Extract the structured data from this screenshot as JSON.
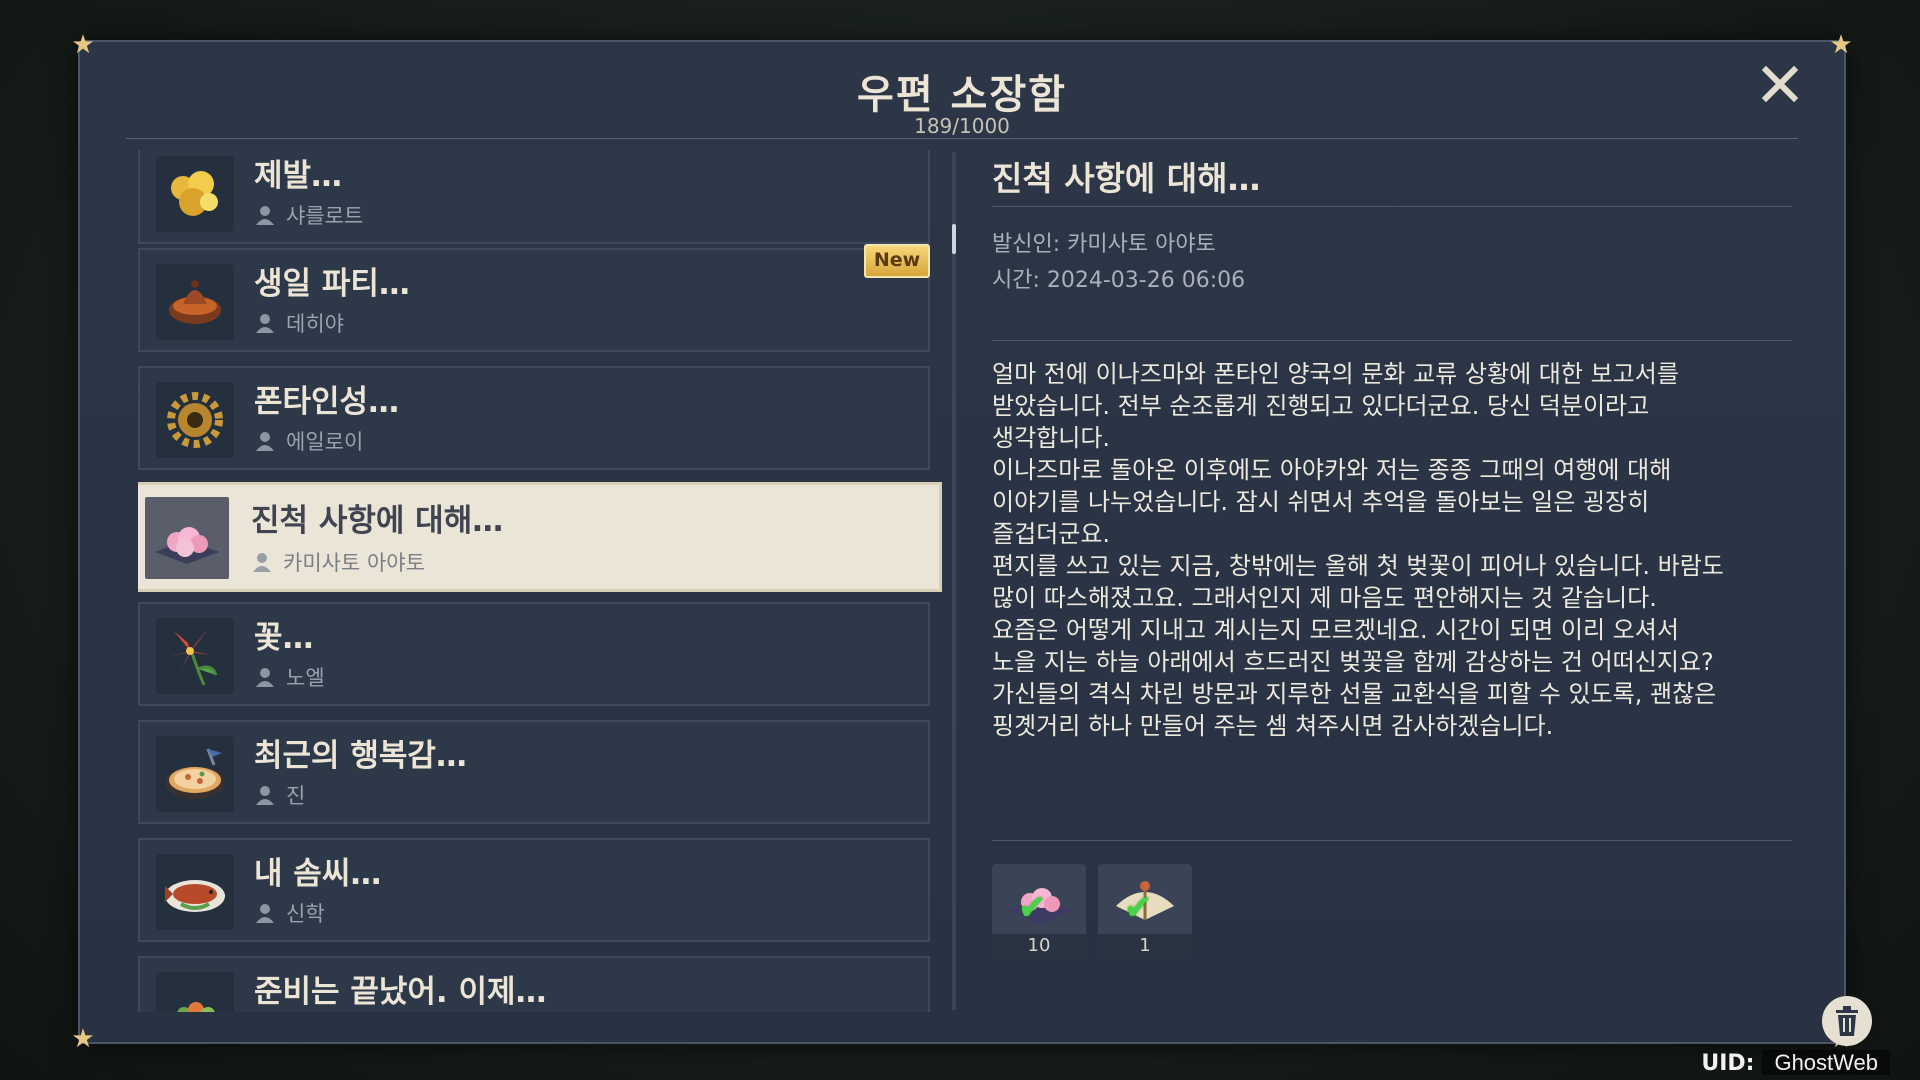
{
  "window": {
    "title": "우편 소장함",
    "count": "189/1000"
  },
  "mail_list": [
    {
      "subject": "제발…",
      "sender": "샤를로트",
      "new": true,
      "icon": "gold-nugget-icon"
    },
    {
      "subject": "생일 파티…",
      "sender": "데히야",
      "new": true,
      "icon": "stew-pot-icon"
    },
    {
      "subject": "폰타인성…",
      "sender": "에일로이",
      "new": false,
      "icon": "gear-icon"
    },
    {
      "subject": "진척 사항에 대해…",
      "sender": "카미사토 아야토",
      "new": false,
      "icon": "sakura-tray-icon",
      "selected": true
    },
    {
      "subject": "꽃…",
      "sender": "노엘",
      "new": false,
      "icon": "flower-icon"
    },
    {
      "subject": "최근의 행복감…",
      "sender": "진",
      "new": false,
      "icon": "pizza-icon"
    },
    {
      "subject": "내 솜씨…",
      "sender": "신학",
      "new": false,
      "icon": "fish-dish-icon"
    },
    {
      "subject": "준비는 끝났어. 이제…",
      "sender": "",
      "new": false,
      "icon": "salad-icon"
    }
  ],
  "badge": {
    "new_label": "New"
  },
  "detail": {
    "title": "진척 사항에 대해…",
    "sender_label": "발신인: 카미사토 아야토",
    "time_label": "시간: 2024-03-26 06:06",
    "body": "얼마 전에 이나즈마와 폰타인 양국의 문화 교류 상황에 대한 보고서를\n받았습니다. 전부 순조롭게 진행되고 있다더군요. 당신 덕분이라고\n생각합니다.\n이나즈마로 돌아온 이후에도 아야카와 저는 종종 그때의 여행에 대해\n이야기를 나누었습니다. 잠시 쉬면서 추억을 돌아보는 일은 굉장히\n즐겁더군요.\n편지를 쓰고 있는 지금, 창밖에는 올해 첫 벚꽃이 피어나 있습니다. 바람도\n많이 따스해졌고요. 그래서인지 제 마음도 편안해지는 것 같습니다.\n요즘은 어떻게 지내고 계시는지 모르겠네요. 시간이 되면 이리 오셔서\n노을 지는 하늘 아래에서 흐드러진 벚꽃을 함께 감상하는 건 어떠신지요?\n가신들의 격식 차린 방문과 지루한 선물 교환식을 피할 수 있도록, 괜찮은\n핑곗거리 하나 만들어 주는 셈 쳐주시면 감사하겠습니다.",
    "attachments": [
      {
        "icon": "sakura-tray-icon",
        "qty": "10",
        "claimed": true
      },
      {
        "icon": "fan-icon",
        "qty": "1",
        "claimed": true
      }
    ]
  },
  "footer": {
    "uid_label": "UID:",
    "uid_value": "GhostWeb"
  },
  "colors": {
    "accent_gold": "#e8c880",
    "selected_bg": "#ebe5d8",
    "panel_bg": "#2c3646",
    "check_green": "#4ad34a"
  }
}
